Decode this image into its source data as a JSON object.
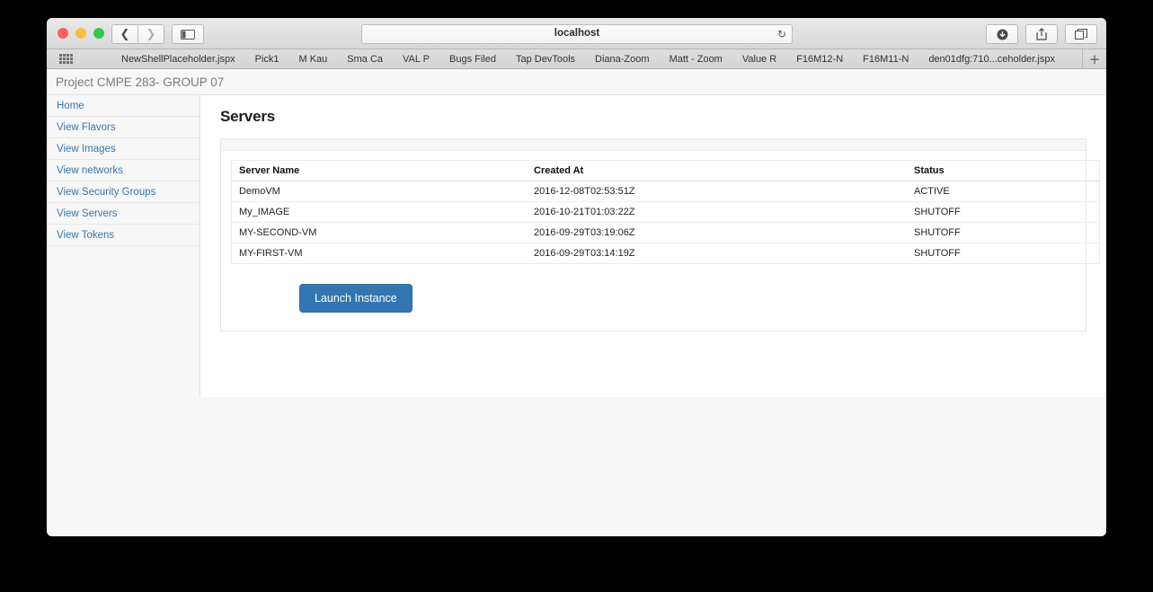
{
  "browser": {
    "window_title": "localhost",
    "address_value": "localhost",
    "reload_icon": "reload-icon",
    "back_icon": "back-chevron-icon",
    "forward_icon": "forward-chevron-icon",
    "sidebar_icon": "sidebar-panel-icon",
    "download_icon": "download-icon",
    "share_icon": "share-icon",
    "tabs_icon": "show-tabs-icon",
    "apps_grid_icon": "apps-grid-icon",
    "new_bookmark_label": "+",
    "bookmarks": [
      "NewShellPlaceholder.jspx",
      "Pick1",
      "M Kau",
      "Sma Ca",
      "VAL P",
      "Bugs Filed",
      "Tap DevTools",
      "Diana-Zoom",
      "Matt - Zoom",
      "Value R",
      "F16M12-N",
      "F16M11-N",
      "den01dfg:710...ceholder.jspx"
    ]
  },
  "page": {
    "project_header": "Project CMPE 283- GROUP 07",
    "sidebar": {
      "items": [
        {
          "label": "Home"
        },
        {
          "label": "View Flavors"
        },
        {
          "label": "View Images"
        },
        {
          "label": "View networks"
        },
        {
          "label": "View Security Groups"
        },
        {
          "label": "View Servers"
        },
        {
          "label": "View Tokens"
        }
      ]
    },
    "main": {
      "heading": "Servers",
      "table": {
        "columns": [
          "Server Name",
          "Created At",
          "Status"
        ],
        "rows": [
          {
            "name": "DemoVM",
            "created_at": "2016-12-08T02:53:51Z",
            "status": "ACTIVE"
          },
          {
            "name": "My_IMAGE",
            "created_at": "2016-10-21T01:03:22Z",
            "status": "SHUTOFF"
          },
          {
            "name": "MY-SECOND-VM",
            "created_at": "2016-09-29T03:19:06Z",
            "status": "SHUTOFF"
          },
          {
            "name": "MY-FIRST-VM",
            "created_at": "2016-09-29T03:14:19Z",
            "status": "SHUTOFF"
          }
        ]
      },
      "launch_button": "Launch Instance"
    }
  },
  "colors": {
    "link": "#3b73af",
    "primary_button": "#3276b1",
    "primary_button_border": "#2d6ca2"
  }
}
